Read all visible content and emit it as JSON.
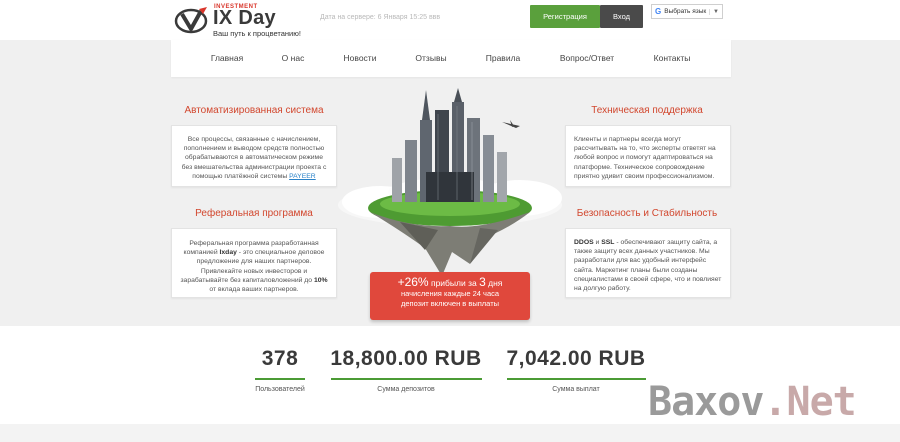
{
  "header": {
    "logo_small": "INVESTMENT",
    "logo_title": "IX Day",
    "logo_tagline": "Ваш путь к процветанию!",
    "server_date": "Дата на сервере: 6 Января 15:25 ввв",
    "register_label": "Регистрация",
    "login_label": "Вход",
    "translate_g": "G",
    "translate_label": "Выбрать язык",
    "translate_caret": "▼"
  },
  "nav": {
    "items": [
      {
        "label": "Главная"
      },
      {
        "label": "О нас"
      },
      {
        "label": "Новости"
      },
      {
        "label": "Отзывы"
      },
      {
        "label": "Правила"
      },
      {
        "label": "Вопрос/Ответ"
      },
      {
        "label": "Контакты"
      }
    ]
  },
  "features": {
    "automation": {
      "title": "Автоматизированная система",
      "text": "Все процессы, связанные с начислением, пополнением и выводом средств полностью обрабатываются в автоматическом режиме без вмешательства администрации проекта с помощью платёжной системы",
      "link": "PAYEER"
    },
    "support": {
      "title": "Техническая поддержка",
      "text": "Клиенты и партнеры всегда могут рассчитывать на то, что эксперты ответят на любой вопрос и помогут адаптироваться на платформе. Техническое сопровождение приятно удивит своим профессионализмом."
    },
    "referral": {
      "title": "Реферальная программа",
      "text_1": "Реферальная программа разработанная компанией",
      "bold_1": "Ixday",
      "text_2": "- это специальное деловое предложение для наших партнеров. Привлекайте новых инвесторов и зарабатывайте без капиталовложений до",
      "bold_2": "10%",
      "text_3": "от вклада ваших партнеров."
    },
    "security": {
      "title": "Безопасность и Стабильность",
      "bold_1": "DDOS",
      "and": "и",
      "bold_2": "SSL",
      "text": "- обеспечивают защиту сайта, а также защиту всех данных участников. Мы разработали для вас удобный интерфейс сайта. Маркетинг планы были созданы специалистами в своей сфере, что и повлияет на долгую работу."
    }
  },
  "promo": {
    "percent": "+26%",
    "profit_text": "прибыли за",
    "days_num": "3",
    "days_word": "дня",
    "line2": "начисления каждые 24 часа",
    "line3": "депозит включен в выплаты"
  },
  "stats": {
    "users_value": "378",
    "users_label": "Пользователей",
    "deposits_value": "18,800.00 RUB",
    "deposits_label": "Сумма депозитов",
    "payouts_value": "7,042.00 RUB",
    "payouts_label": "Сумма выплат"
  },
  "watermark": {
    "part1": "Baxov",
    "part2": ".Net"
  },
  "colors": {
    "accent_red": "#d2472e",
    "register_green": "#5aa03c",
    "login_dark": "#4a4a4a",
    "promo_red": "#e0483c",
    "stat_bar_green": "#4b9b35"
  }
}
